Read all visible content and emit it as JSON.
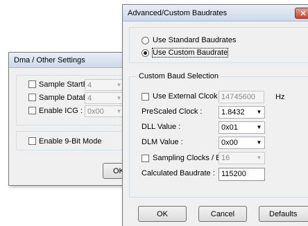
{
  "dma_dialog": {
    "title": "Dma / Other Settings",
    "sample_startbit_label": "Sample StartBit :",
    "sample_startbit_value": "4",
    "sample_databit_label": "Sample DataBit :",
    "sample_databit_value": "4",
    "enable_icg_label": "Enable ICG :",
    "enable_icg_value": "0x00",
    "enable_9bit_label": "Enable 9-Bit Mode",
    "ok_label": "OK"
  },
  "baud_dialog": {
    "title": "Advanced/Custom Baudrates",
    "close_glyph": "✕",
    "use_standard_label": "Use Standard Baudrates",
    "use_custom_label": "Use Custom Baudrate",
    "custom_group_title": "Custom Baud Selection",
    "use_external_clock_label": "Use External Clcok",
    "external_clock_value": "14745600",
    "external_clock_unit": "Hz",
    "prescaled_clock_label": "PreScaled Clock :",
    "prescaled_clock_value": "1.8432",
    "dll_label": "DLL Value :",
    "dll_value": "0x01",
    "dlm_label": "DLM Value :",
    "dlm_value": "0x00",
    "sampling_clocks_label": "Sampling Clocks / Bit :",
    "sampling_clocks_value": "16",
    "calculated_label": "Calculated Baudrate :",
    "calculated_value": "115200",
    "ok_label": "OK",
    "cancel_label": "Cancel",
    "defaults_label": "Defaults"
  }
}
